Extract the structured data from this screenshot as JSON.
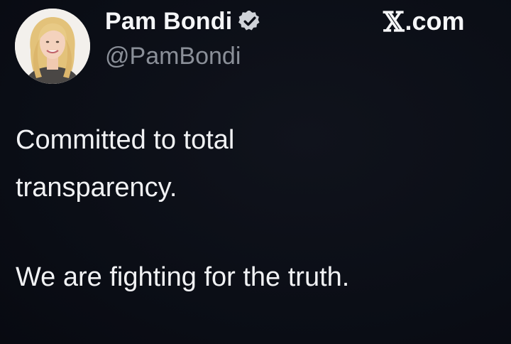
{
  "profile": {
    "display_name": "Pam Bondi",
    "handle": "@PamBondi",
    "verified": true,
    "avatar_icon": "profile-photo-avatar"
  },
  "brand": {
    "x_glyph": "𝕏",
    "domain": ".com"
  },
  "tweet": {
    "lines": [
      "Committed to total",
      "transparency.",
      "We are fighting for the truth."
    ]
  },
  "colors": {
    "background": "#0b0e16",
    "text": "#f1f2f4",
    "handle": "#8a8f98",
    "verified_badge": "#d0d3d9"
  }
}
